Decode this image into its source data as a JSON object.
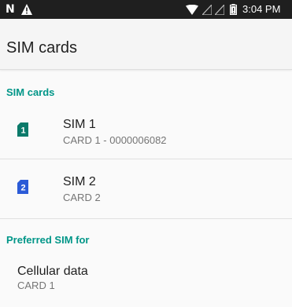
{
  "status_bar": {
    "time": "3:04 PM",
    "icons": [
      "n-icon",
      "warning-icon",
      "wifi-icon",
      "signal-icon",
      "signal-icon",
      "battery-icon"
    ],
    "n_glyph": "N"
  },
  "app_bar": {
    "title": "SIM cards"
  },
  "sections": {
    "sim_cards_header": "SIM cards",
    "preferred_header": "Preferred SIM for"
  },
  "sims": [
    {
      "title": "SIM 1",
      "subtitle": "CARD 1 - 0000006082",
      "badge": "1",
      "color": "#0b7a6a"
    },
    {
      "title": "SIM 2",
      "subtitle": "CARD 2",
      "badge": "2",
      "color": "#2b5bd7"
    }
  ],
  "preferred": {
    "cellular_data_label": "Cellular data",
    "cellular_data_value": "CARD 1"
  },
  "colors": {
    "accent": "#009688",
    "status_bar": "#1f1f1f"
  }
}
